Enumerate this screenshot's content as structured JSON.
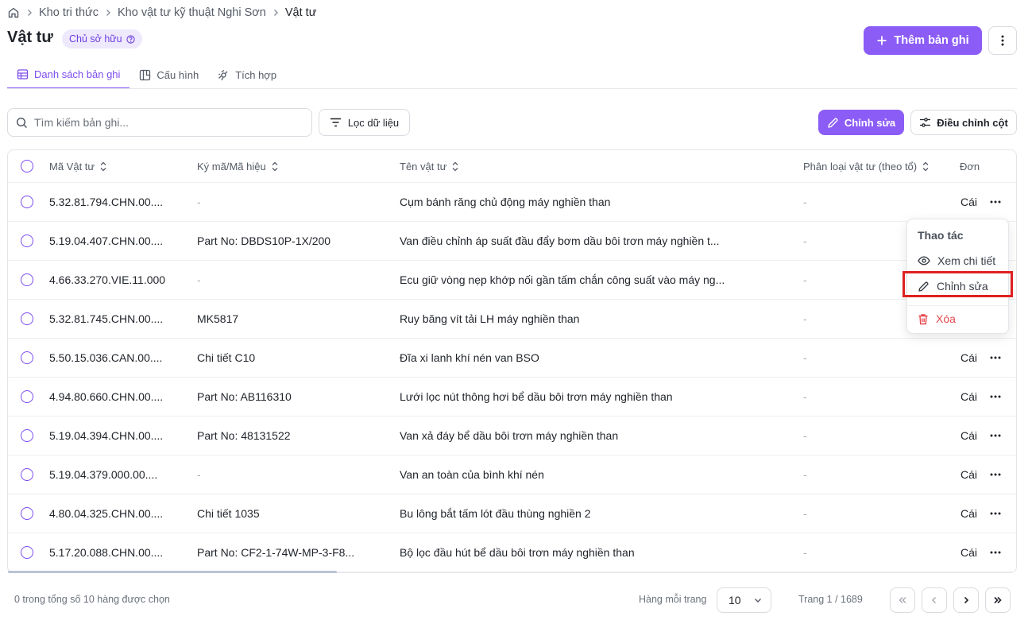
{
  "breadcrumb": {
    "items": [
      "Kho tri thức",
      "Kho vật tư kỹ thuật Nghi Sơn",
      "Vật tư"
    ]
  },
  "header": {
    "title": "Vật tư",
    "owner_badge": "Chủ sở hữu",
    "add_label": "Thêm bản ghi"
  },
  "tabs": [
    {
      "label": "Danh sách bản ghi",
      "active": true
    },
    {
      "label": "Cấu hình",
      "active": false
    },
    {
      "label": "Tích hợp",
      "active": false
    }
  ],
  "toolbar": {
    "search_placeholder": "Tìm kiếm bản ghi...",
    "filter_label": "Lọc dữ liệu",
    "edit_label": "Chỉnh sửa",
    "columns_label": "Điều chỉnh cột"
  },
  "table": {
    "columns": [
      "Mã Vật tư",
      "Ký mã/Mã hiệu",
      "Tên vật tư",
      "Phân loại vật tư (theo tổ)",
      "Đơn"
    ],
    "rows": [
      {
        "code": "5.32.81.794.CHN.00....",
        "mark": "-",
        "name": "Cụm bánh răng chủ động máy nghiền than",
        "category": "-",
        "unit": "Cái"
      },
      {
        "code": "5.19.04.407.CHN.00....",
        "mark": "Part No: DBDS10P-1X/200",
        "name": "Van điều chỉnh áp suất đầu đẩy bơm dầu bôi trơn máy nghiền t...",
        "category": "-",
        "unit": ""
      },
      {
        "code": "4.66.33.270.VIE.11.000",
        "mark": "-",
        "name": "Ecu giữ vòng nẹp khớp nối gần tấm chắn công suất vào máy ng...",
        "category": "-",
        "unit": ""
      },
      {
        "code": "5.32.81.745.CHN.00....",
        "mark": "MK5817",
        "name": "Ruy băng vít tải LH máy nghiền than",
        "category": "-",
        "unit": ""
      },
      {
        "code": "5.50.15.036.CAN.00....",
        "mark": "Chi tiết C10",
        "name": "Đĩa xi lanh khí nén van BSO",
        "category": "-",
        "unit": "Cái"
      },
      {
        "code": "4.94.80.660.CHN.00....",
        "mark": "Part No: AB116310",
        "name": "Lưới lọc nút thông hơi bể dầu bôi trơn máy nghiền than",
        "category": "-",
        "unit": "Cái"
      },
      {
        "code": "5.19.04.394.CHN.00....",
        "mark": "Part No: 48131522",
        "name": "Van xả đáy bể dầu bôi trơn máy nghiền than",
        "category": "-",
        "unit": "Cái"
      },
      {
        "code": "5.19.04.379.000.00....",
        "mark": "-",
        "name": "Van an toàn của bình khí nén",
        "category": "-",
        "unit": "Cái"
      },
      {
        "code": "4.80.04.325.CHN.00....",
        "mark": "Chi tiết 1035",
        "name": "Bu lông bắt tấm lót đầu thùng nghiền 2",
        "category": "-",
        "unit": "Cái"
      },
      {
        "code": "5.17.20.088.CHN.00....",
        "mark": "Part No: CF2-1-74W-MP-3-F8...",
        "name": "Bộ lọc đầu hút bể dầu bôi trơn máy nghiền than",
        "category": "-",
        "unit": "Cái"
      }
    ]
  },
  "menu": {
    "title": "Thao tác",
    "view": "Xem chi tiết",
    "edit": "Chỉnh sửa",
    "delete": "Xóa"
  },
  "footer": {
    "selected": "0 trong tổng số 10 hàng được chọn",
    "rows_per_page_label": "Hàng mỗi trang",
    "rows_per_page": "10",
    "page_info": "Trang 1 / 1689"
  },
  "colors": {
    "accent": "#8c5cf6",
    "danger": "#e5484d",
    "highlight": "#e02020"
  }
}
